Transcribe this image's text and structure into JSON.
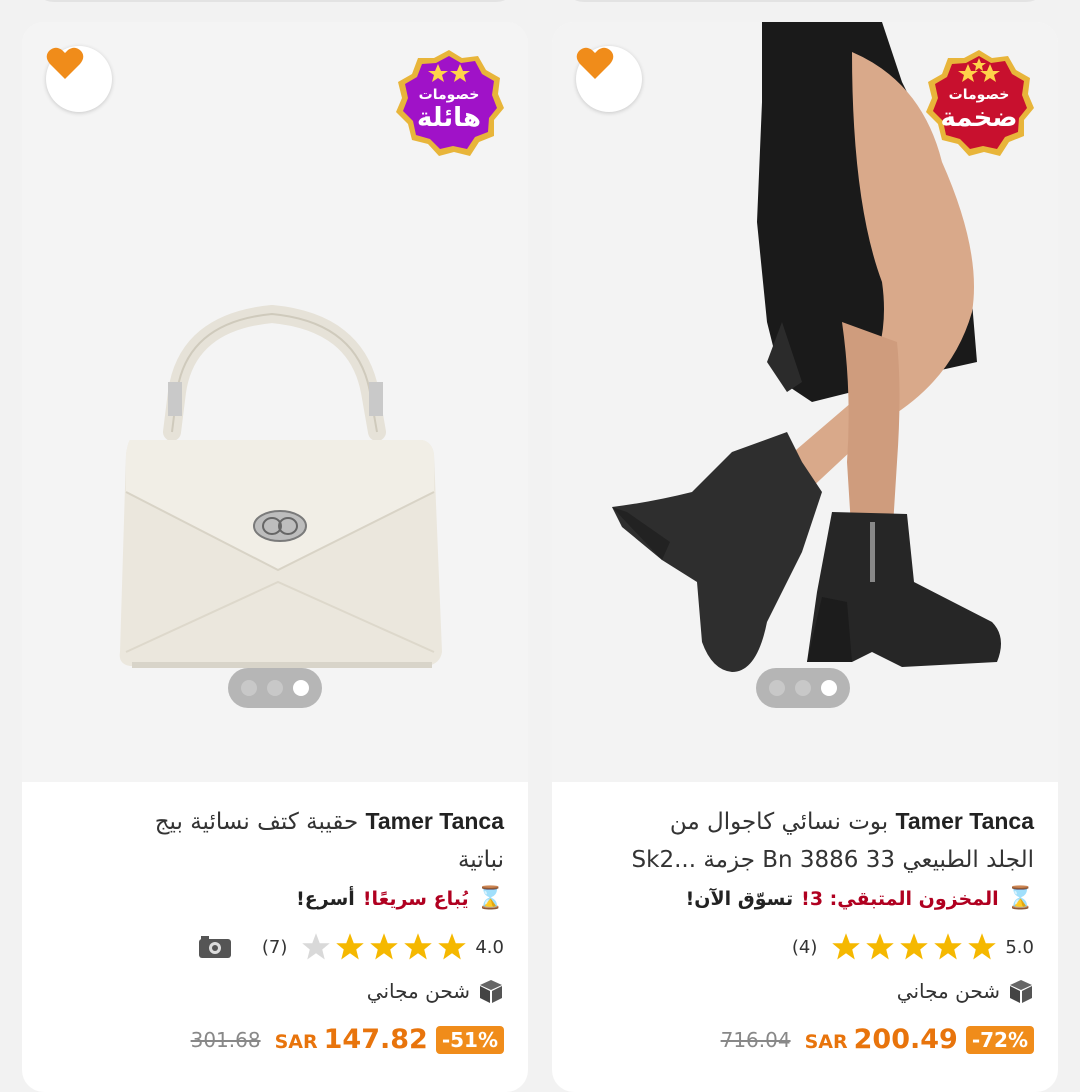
{
  "products": [
    {
      "side": "right",
      "brand": "Tamer Tanca",
      "title_line1": "بوت نسائي كاجوال من",
      "title_line2": "الجلد الطبيعي 33 Bn 3886 جزمة ...Sk2",
      "badge_top": "خصومات",
      "badge_main": "ضخمة",
      "badge_color": "#c8102e",
      "urgency_red": "المخزون المتبقي: 3!",
      "urgency_dark": "تسوّق الآن!",
      "rating": "5.0",
      "stars_filled": 5,
      "reviews": "(4)",
      "shipping": "شحن مجاني",
      "discount": "-72%",
      "currency": "SAR",
      "price": "200.49",
      "old_price": "716.04",
      "carousel_active_index": 2
    },
    {
      "side": "left",
      "brand": "Tamer Tanca",
      "title_line1": "حقيبة كتف نسائية بيج",
      "title_line2": "نباتية",
      "badge_top": "خصومات",
      "badge_main": "هائلة",
      "badge_color": "#a012c8",
      "urgency_red": "يُباع سريعًا!",
      "urgency_dark": "أسرع!",
      "rating": "4.0",
      "stars_filled": 4,
      "reviews": "(7)",
      "shipping": "شحن مجاني",
      "discount": "-51%",
      "currency": "SAR",
      "price": "147.82",
      "old_price": "301.68",
      "carousel_active_index": 2
    }
  ],
  "icons": {
    "favorite": "heart-icon",
    "urgency": "hourglass-icon",
    "shipping": "package-icon",
    "photo_reviews": "camera-icon"
  },
  "colors": {
    "heart": "#f08c1a",
    "star": "#f5b800",
    "star_empty": "#d9d9d9",
    "price": "#e8740c",
    "urgency": "#b00020"
  }
}
